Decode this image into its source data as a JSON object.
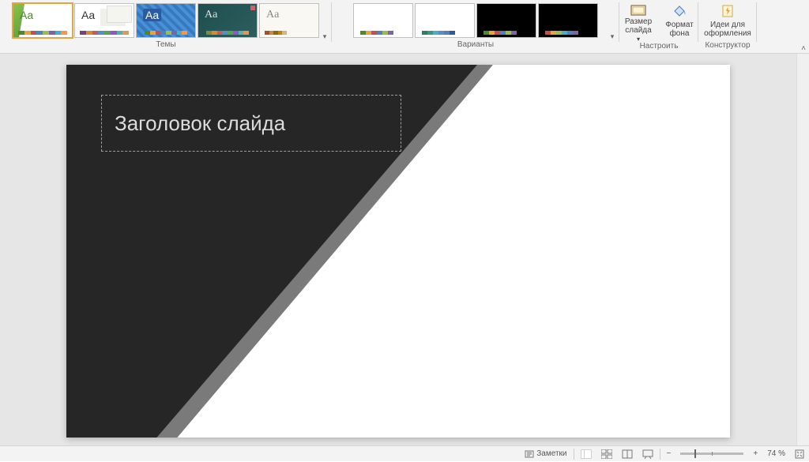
{
  "ribbon": {
    "themes": {
      "label": "Темы",
      "items": [
        {
          "aa": "Aa"
        },
        {
          "aa": "Aa"
        },
        {
          "aa": "Aa"
        },
        {
          "aa": "Aa"
        },
        {
          "aa": "Aa"
        }
      ]
    },
    "variants": {
      "label": "Варианты"
    },
    "customize": {
      "label": "Настроить",
      "slide_size": "Размер слайда",
      "bg_format": "Формат фона"
    },
    "designer": {
      "label": "Конструктор",
      "ideas": "Идеи для оформления"
    }
  },
  "slide": {
    "title": "Заголовок слайда"
  },
  "status": {
    "notes": "Заметки",
    "zoom": "74 %"
  },
  "swatches": {
    "rainbow": [
      "#4a8a2c",
      "#e8a33d",
      "#c0504d",
      "#4f81bd",
      "#9bbb59",
      "#8064a2",
      "#4bacc6",
      "#f79646"
    ],
    "rb2": [
      "#7b3f7b",
      "#d08c3a",
      "#c55a5a",
      "#5a8cc5",
      "#5aa05a",
      "#8c5ac5",
      "#5ab0b0",
      "#d99a5a"
    ]
  }
}
